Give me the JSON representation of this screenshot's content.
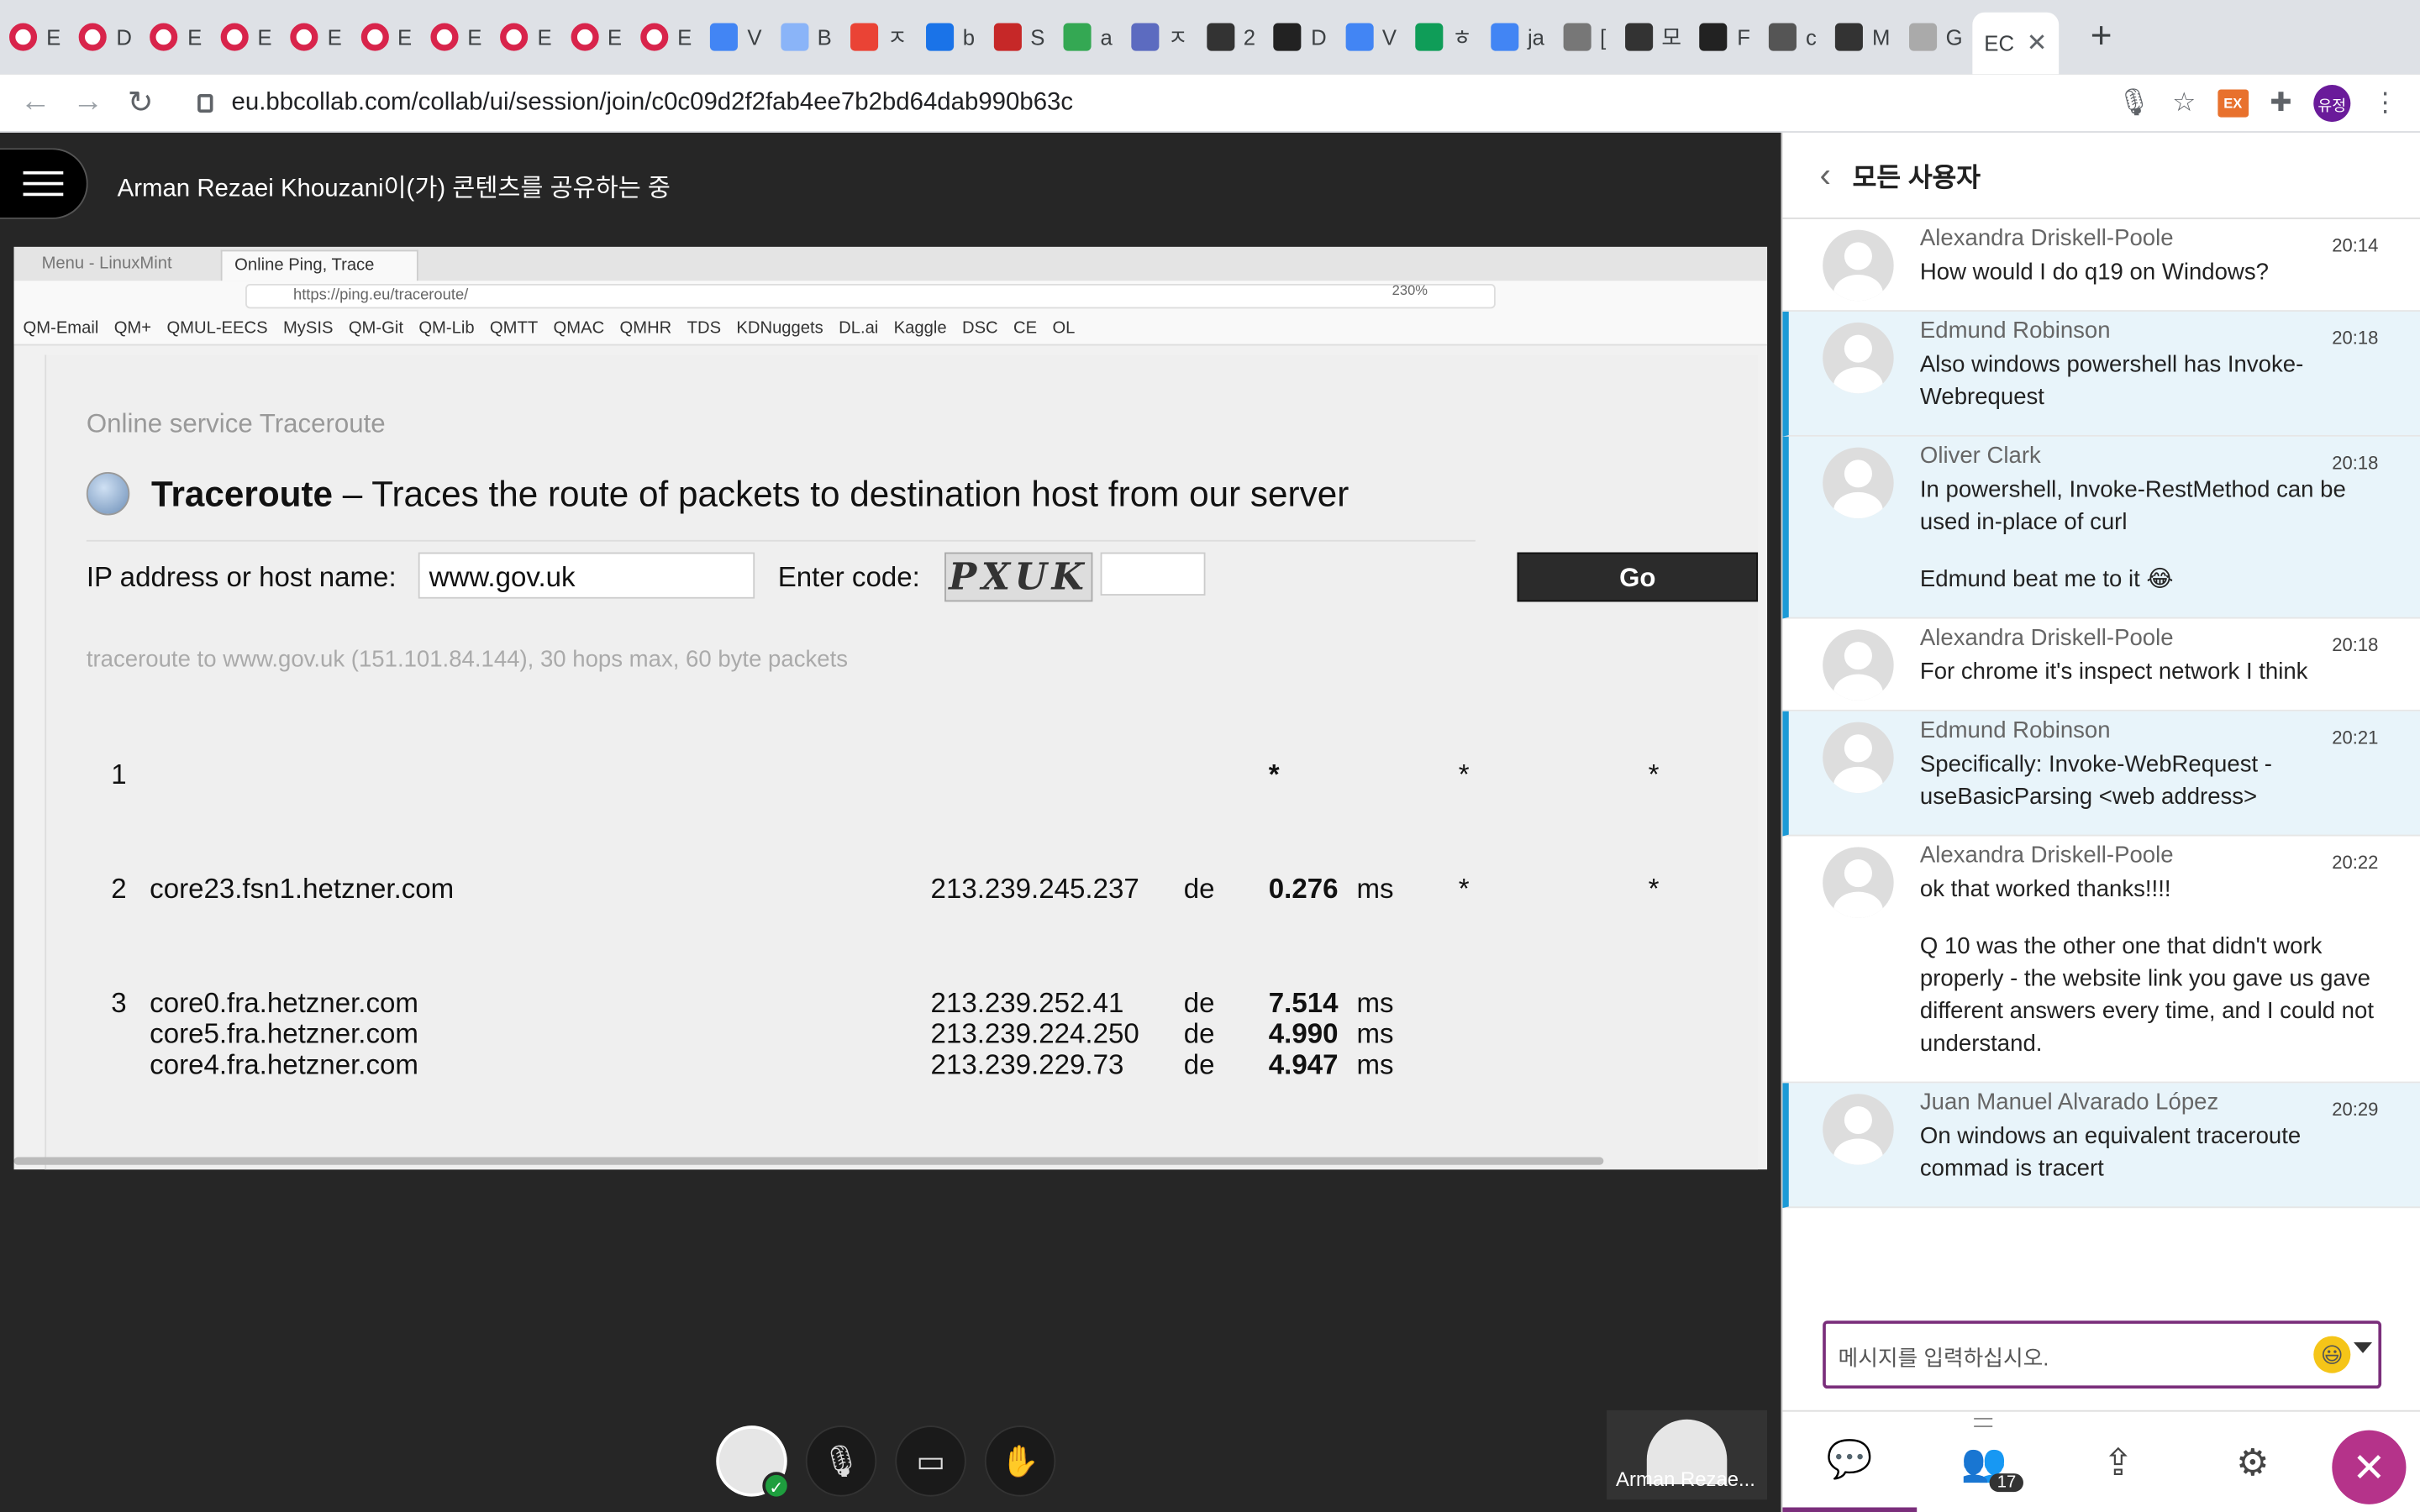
{
  "browser": {
    "tabs": [
      "E",
      "D",
      "E",
      "E",
      "E",
      "E",
      "E",
      "E",
      "E",
      "E",
      "V",
      "B",
      "ㅈ",
      "b",
      "S",
      "a",
      "ㅈ",
      "2",
      "D",
      "V",
      "ㅎ",
      "ja",
      "[",
      "모",
      "F",
      "c",
      "M",
      "G"
    ],
    "active_tab": "EC",
    "url": "eu.bbcollab.com/collab/ui/session/join/c0c09d2f2fab4ee7b2bd64dab990b63c",
    "profile": "유정",
    "ext_label": "EX"
  },
  "session": {
    "sharing_title": "Arman Rezaei Khouzani이(가) 콘텐츠를 공유하는 중",
    "presenter_tile": "Arman Rezae..."
  },
  "shared_screen": {
    "tab1": "Menu - LinuxMint",
    "tab2": "Online Ping, Trace",
    "url": "https://ping.eu/traceroute/",
    "zoom": "230%",
    "bookmarks": [
      "QM-Email",
      "QM+",
      "QMUL-EECS",
      "MySIS",
      "QM-Git",
      "QM-Lib",
      "QMTT",
      "QMAC",
      "QMHR",
      "TDS",
      "KDNuggets",
      "DL.ai",
      "Kaggle",
      "DSC",
      "CE",
      "OL"
    ],
    "service_title": "Online service Traceroute",
    "heading_bold": "Traceroute",
    "heading_rest": " – Traces the route of packets to destination host from our server",
    "host_label": "IP address or host name:",
    "host_value": "www.gov.uk",
    "code_label": "Enter code:",
    "captcha": "PXUK",
    "go": "Go",
    "trace_info": "traceroute to www.gov.uk (151.101.84.144), 30 hops max, 60 byte packets",
    "hops": [
      {
        "n": "1",
        "host": "",
        "ip": "",
        "cc": "",
        "time": "*",
        "t2": "*",
        "t3": "*",
        "unit": ""
      },
      {
        "n": "2",
        "host": "core23.fsn1.hetzner.com",
        "ip": "213.239.245.237",
        "cc": "de",
        "time": "0.276",
        "unit": "ms",
        "t2": "*",
        "t3": "*"
      },
      {
        "n": "3",
        "host": "core0.fra.hetzner.com",
        "ip": "213.239.252.41",
        "cc": "de",
        "time": "7.514",
        "unit": "ms",
        "t2": "",
        "t3": ""
      },
      {
        "n": "",
        "host": "core5.fra.hetzner.com",
        "ip": "213.239.224.250",
        "cc": "de",
        "time": "4.990",
        "unit": "ms",
        "t2": "",
        "t3": ""
      },
      {
        "n": "",
        "host": "core4.fra.hetzner.com",
        "ip": "213.239.229.73",
        "cc": "de",
        "time": "4.947",
        "unit": "ms",
        "t2": "",
        "t3": ""
      }
    ]
  },
  "panel": {
    "title": "모든 사용자",
    "input_placeholder": "메시지를 입력하십시오.",
    "participants_count": "17",
    "messages": [
      {
        "who": "Alexandra Driskell-Poole",
        "time": "20:14",
        "hl": false,
        "lines": [
          "How would I do q19 on Windows?"
        ]
      },
      {
        "who": "Edmund Robinson",
        "time": "20:18",
        "hl": true,
        "lines": [
          "Also windows powershell has Invoke-Webrequest"
        ]
      },
      {
        "who": "Oliver Clark",
        "time": "20:18",
        "hl": true,
        "lines": [
          "In powershell, Invoke-RestMethod can be used in-place of curl",
          "Edmund beat me to it 😂"
        ]
      },
      {
        "who": "Alexandra Driskell-Poole",
        "time": "20:18",
        "hl": false,
        "lines": [
          "For chrome it's inspect network I think"
        ]
      },
      {
        "who": "Edmund Robinson",
        "time": "20:21",
        "hl": true,
        "lines": [
          "Specifically: Invoke-WebRequest -useBasicParsing <web address>"
        ]
      },
      {
        "who": "Alexandra Driskell-Poole",
        "time": "20:22",
        "hl": false,
        "lines": [
          "ok that worked thanks!!!!",
          "Q 10 was the other one that didn't work properly - the website link you gave us gave different answers every time, and I could not understand."
        ]
      },
      {
        "who": "Juan Manuel Alvarado López",
        "time": "20:29",
        "hl": true,
        "lines": [
          "On windows an equivalent traceroute commad is tracert"
        ]
      }
    ]
  }
}
